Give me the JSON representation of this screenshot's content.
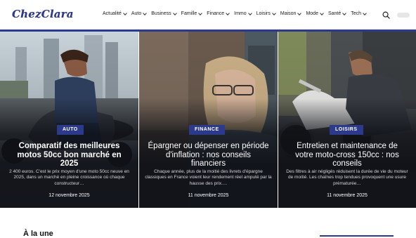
{
  "header": {
    "logo": "ChezClara",
    "nav": [
      {
        "label": "Actualité"
      },
      {
        "label": "Auto"
      },
      {
        "label": "Business"
      },
      {
        "label": "Famille"
      },
      {
        "label": "Finance"
      },
      {
        "label": "Immo"
      },
      {
        "label": "Loisirs"
      },
      {
        "label": "Maison"
      },
      {
        "label": "Mode"
      },
      {
        "label": "Santé"
      },
      {
        "label": "Tech"
      }
    ],
    "search_icon": "search-icon",
    "accent_color": "#2d3a8c"
  },
  "cards": [
    {
      "category": "AUTO",
      "title": "Comparatif des meilleures motos 50cc bon marché en 2025",
      "excerpt": "2 400 euros. C'est le prix moyen d'une moto 50cc neuve en 2025, dans un marché en pleine croissance où chaque constructeur…",
      "date": "12 novembre 2025"
    },
    {
      "category": "FINANCE",
      "title": "Épargner ou dépenser en période d'inflation : nos conseils financiers",
      "excerpt": "Chaque année, plus de la moitié des livrets d'épargne classiques en France voient leur rendement réel amputé par la hausse des prix.…",
      "date": "11 novembre 2025"
    },
    {
      "category": "LOISIRS",
      "title": "Entretien et maintenance de votre moto-cross 150cc : nos conseils",
      "excerpt": "Des filtres à air négligés réduisent la durée de vie du moteur de moitié. Les chaînes trop tendues provoquent une usure prématurée…",
      "date": "11 novembre 2025"
    }
  ],
  "section": {
    "title": "À la une"
  }
}
